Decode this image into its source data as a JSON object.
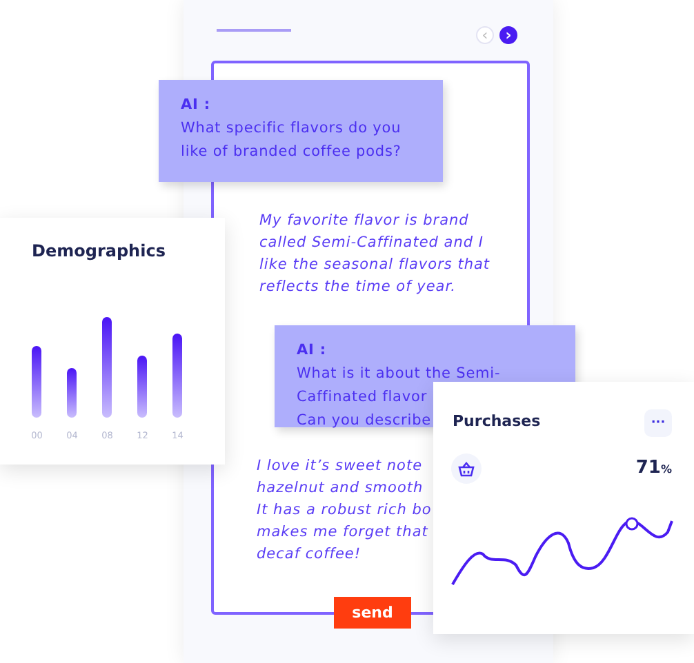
{
  "chat": {
    "nav": [
      {
        "label": "‹",
        "selected": false
      },
      {
        "label": "›",
        "selected": true
      }
    ],
    "messages": [
      {
        "kind": "ai",
        "speaker": "AI :",
        "lines": [
          "What specific flavors do you",
          "like of branded coffee pods?"
        ]
      },
      {
        "kind": "user",
        "lines": [
          "My favorite flavor is brand",
          "called Semi-Caffinated and I",
          "like the seasonal flavors that",
          "reflects the time of year."
        ]
      },
      {
        "kind": "ai",
        "speaker": "AI :",
        "lines": [
          "What is it about the Semi-",
          "Caffinated flavor",
          "Can you describe"
        ]
      },
      {
        "kind": "user",
        "lines": [
          "I love it’s sweet note",
          "hazelnut and smooth",
          "It has a robust rich bo",
          "makes me forget that",
          "decaf coffee!"
        ]
      }
    ],
    "send_button": "send"
  },
  "demographics": {
    "title": "Demographics",
    "labels": [
      "00",
      "04",
      "08",
      "12",
      "14"
    ]
  },
  "purchases": {
    "title": "Purchases",
    "more": "···",
    "value": "71",
    "unit": "%"
  }
}
